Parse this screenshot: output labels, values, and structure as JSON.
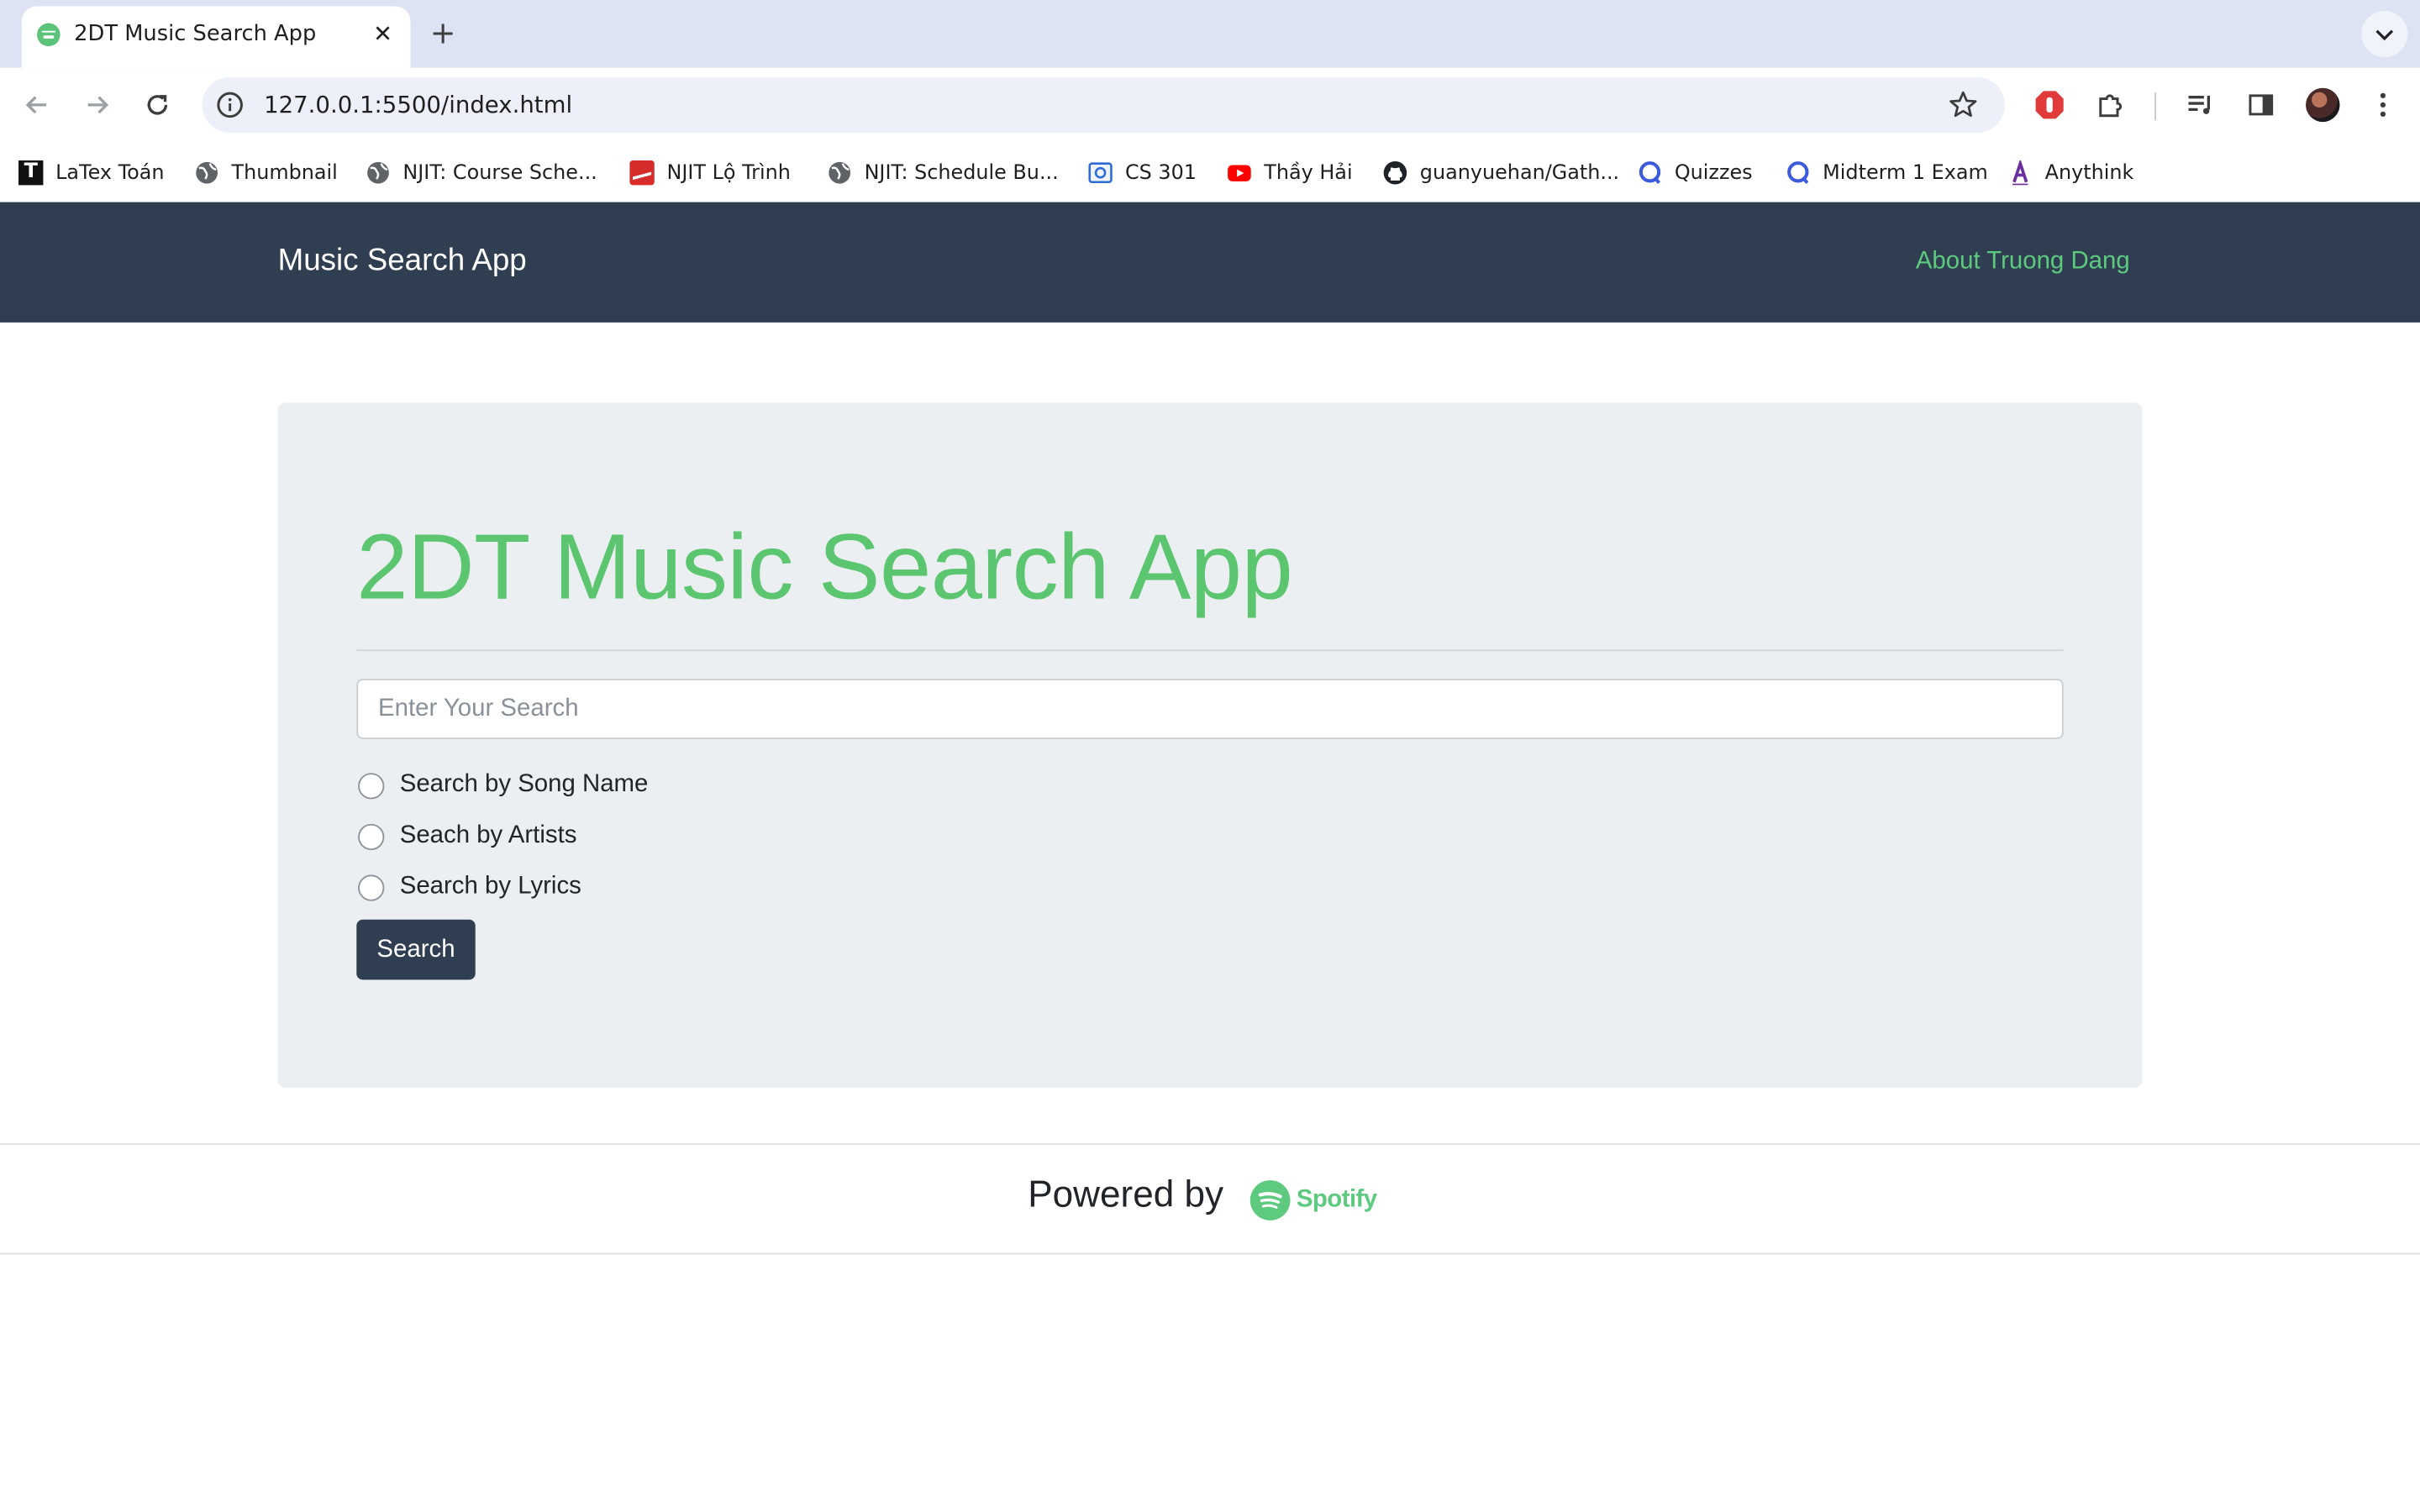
{
  "browser": {
    "tab": {
      "title": "2DT Music Search App",
      "close": "✕",
      "favicon": "spotify-favicon"
    },
    "new_tab": "+",
    "url": "127.0.0.1:5500/index.html",
    "bookmarks": [
      {
        "label": "LaTex Toán",
        "icon": "latex-t-icon"
      },
      {
        "label": "Thumbnail",
        "icon": "globe-icon"
      },
      {
        "label": "NJIT: Course Sche...",
        "icon": "globe-icon"
      },
      {
        "label": "NJIT Lộ Trình",
        "icon": "njit-icon"
      },
      {
        "label": "NJIT: Schedule Bu...",
        "icon": "globe-icon"
      },
      {
        "label": "CS 301",
        "icon": "canvas-icon"
      },
      {
        "label": "Thầy Hải",
        "icon": "youtube-icon"
      },
      {
        "label": "guanyuehan/Gath...",
        "icon": "github-icon"
      },
      {
        "label": "Quizzes",
        "icon": "quiz-icon"
      },
      {
        "label": "Midterm 1 Exam",
        "icon": "quiz-icon"
      },
      {
        "label": "Anythink",
        "icon": "anythink-icon"
      }
    ]
  },
  "navbar": {
    "brand": "Music Search App",
    "about": "About Truong Dang"
  },
  "main": {
    "title": "2DT Music Search App",
    "search_placeholder": "Enter Your Search",
    "search_value": "",
    "options": [
      {
        "label": "Search by Song Name",
        "checked": false
      },
      {
        "label": "Seach by Artists",
        "checked": false
      },
      {
        "label": "Search by Lyrics",
        "checked": false
      }
    ],
    "search_button": "Search"
  },
  "footer": {
    "powered_by": "Powered by",
    "logo_text": "Spotify"
  },
  "colors": {
    "navbar_bg": "#2f3e50",
    "accent_green": "#5cc570",
    "jumbotron_bg": "#ebeff1"
  }
}
